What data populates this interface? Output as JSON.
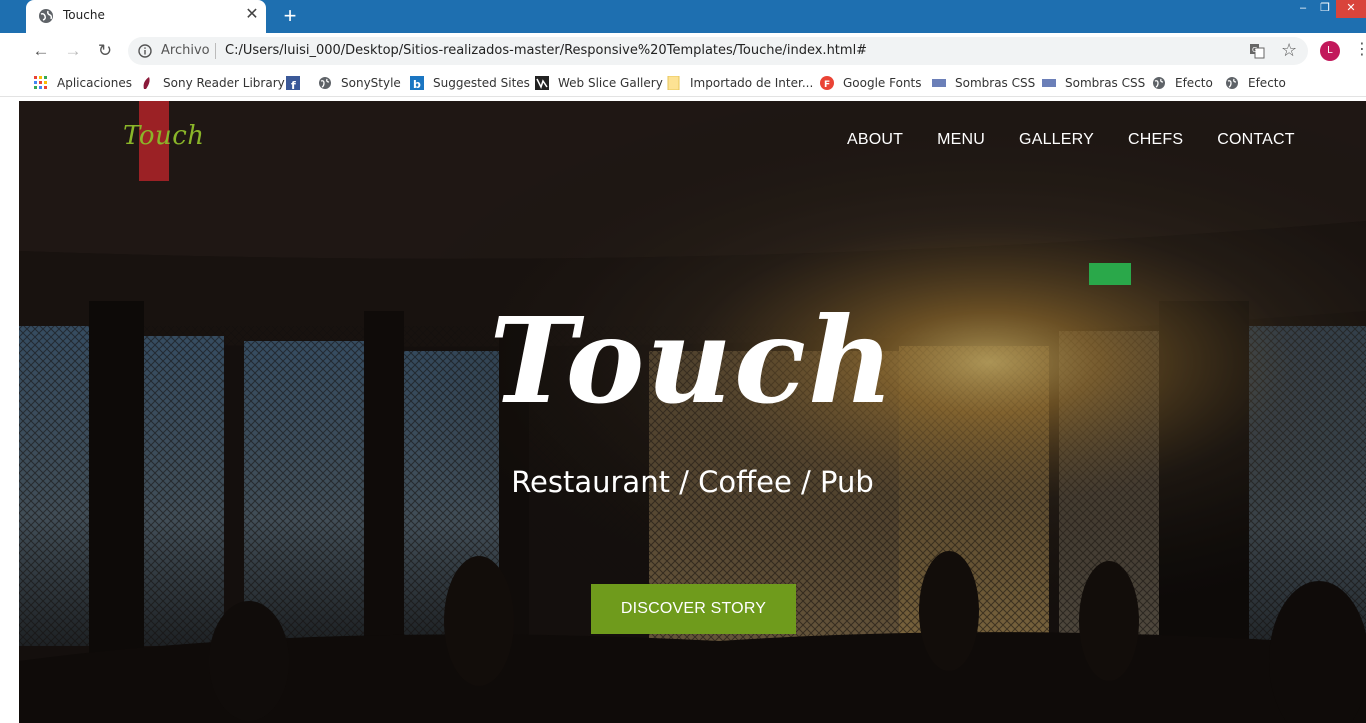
{
  "browser": {
    "tab_title": "Touche",
    "tab_close": "✕",
    "new_tab": "+",
    "scheme_label": "Archivo",
    "url": "C:/Users/luisi_000/Desktop/Sitios-realizados-master/Responsive%20Templates/Touche/index.html#",
    "avatar_letter": "L",
    "icons": {
      "back": "back-arrow-icon",
      "forward": "forward-arrow-icon",
      "reload": "reload-icon",
      "info": "info-icon",
      "translate": "translate-icon",
      "star": "star-icon",
      "menu": "kebab-menu-icon"
    },
    "colors": {
      "titlebar": "#1e6fb0",
      "avatar": "#c2185b"
    }
  },
  "bookmarks": [
    {
      "label": "Aplicaciones",
      "icon": "apps-grid-icon"
    },
    {
      "label": "Sony Reader Library",
      "icon": "sony-reader-icon"
    },
    {
      "label": "",
      "icon": "facebook-icon"
    },
    {
      "label": "SonyStyle",
      "icon": "globe-icon"
    },
    {
      "label": "Suggested Sites",
      "icon": "bing-icon"
    },
    {
      "label": "Web Slice Gallery",
      "icon": "web-slice-icon"
    },
    {
      "label": "Importado de Inter...",
      "icon": "folder-icon"
    },
    {
      "label": "Google Fonts",
      "icon": "google-fonts-icon"
    },
    {
      "label": "Sombras CSS",
      "icon": "bookmark-page-icon"
    },
    {
      "label": "Sombras CSS",
      "icon": "bookmark-page-icon"
    },
    {
      "label": "Efecto",
      "icon": "globe-icon"
    },
    {
      "label": "Efecto",
      "icon": "globe-icon"
    }
  ],
  "site": {
    "brand": "Touch",
    "nav": [
      "ABOUT",
      "MENU",
      "GALLERY",
      "CHEFS",
      "CONTACT"
    ],
    "hero_title": "Touch",
    "hero_subtitle": "Restaurant / Coffee / Pub",
    "cta_label": "DISCOVER STORY",
    "colors": {
      "brand": "#8ab529",
      "cta": "#6f9b1c"
    }
  }
}
